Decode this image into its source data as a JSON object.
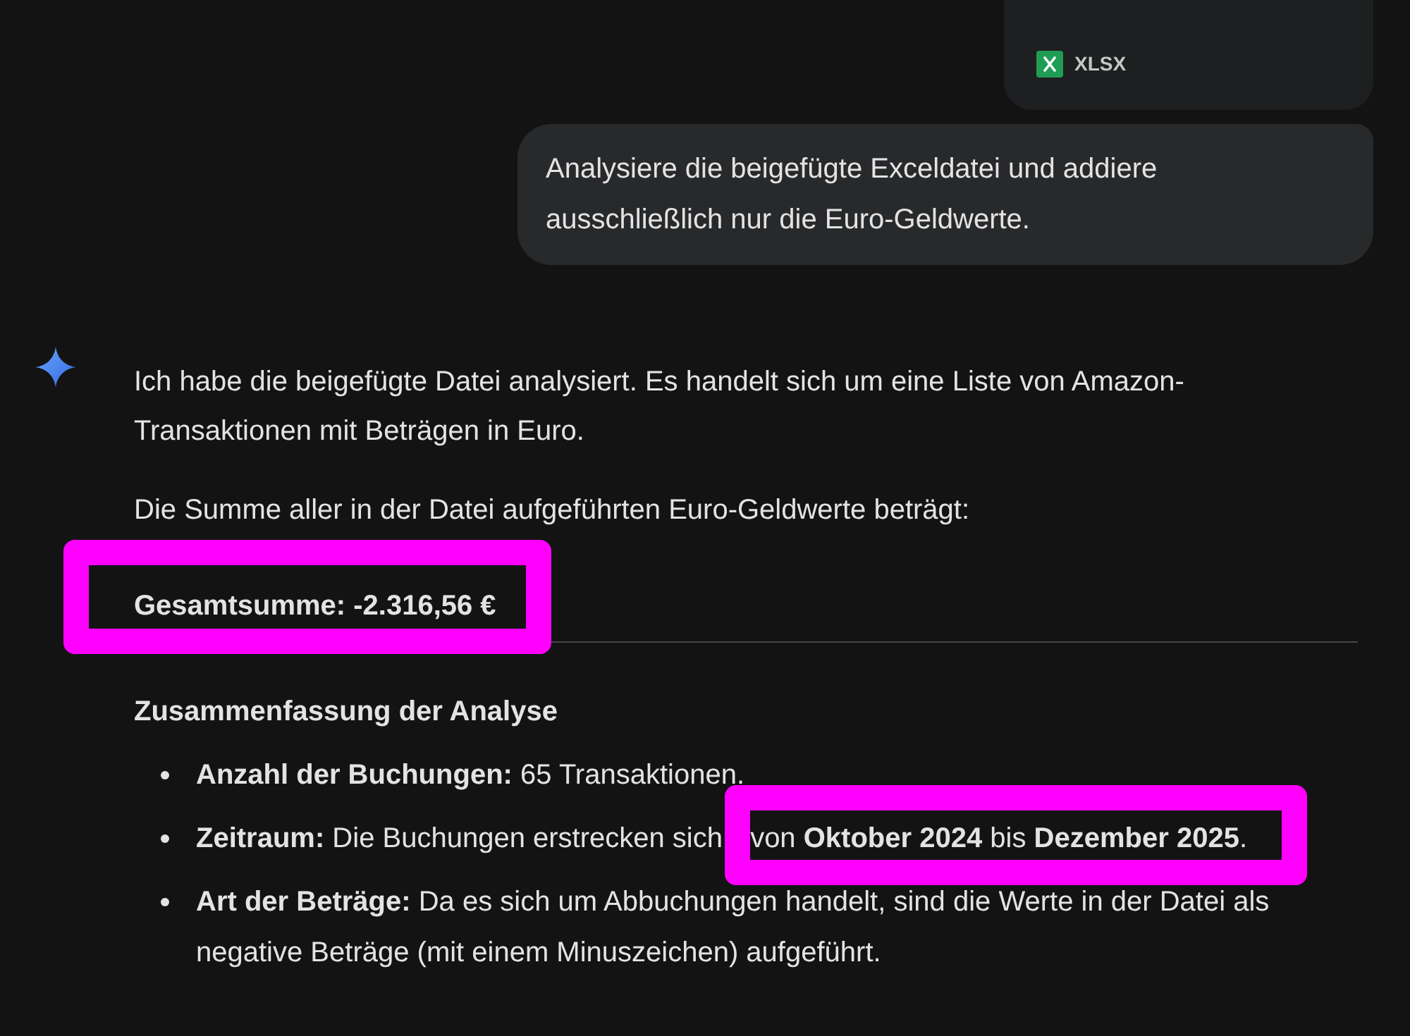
{
  "attachment": {
    "file_type": "XLSX"
  },
  "user_message": {
    "text": "Analysiere die beigefügte Exceldatei und addiere ausschließlich nur die Euro-Geldwerte."
  },
  "response": {
    "paragraphs": [
      "Ich habe die beigefügte Datei analysiert. Es handelt sich um eine Liste von Amazon-Transaktionen mit Beträgen in Euro.",
      "Die Summe aller in der Datei aufgeführten Euro-Geldwerte beträgt:"
    ],
    "total": {
      "text": "Gesamtsumme: -2.316,56 €",
      "highlighted": true
    },
    "section_heading": "Zusammenfassung der Analyse",
    "bullets": [
      {
        "text": "**Anzahl der Buchungen:** 65 Transaktionen."
      },
      {
        "text": "**Zeitraum:** Die Buchungen erstrecken sich",
        "highlighted_text": "von **Oktober 2024** bis **Dezember 2025**."
      },
      {
        "text": "**Art der Beträge:** Da es sich um Abbuchungen handelt, sind die Werte in der Datei als negative Beträge (mit einem Minuszeichen) aufgeführt."
      }
    ]
  }
}
